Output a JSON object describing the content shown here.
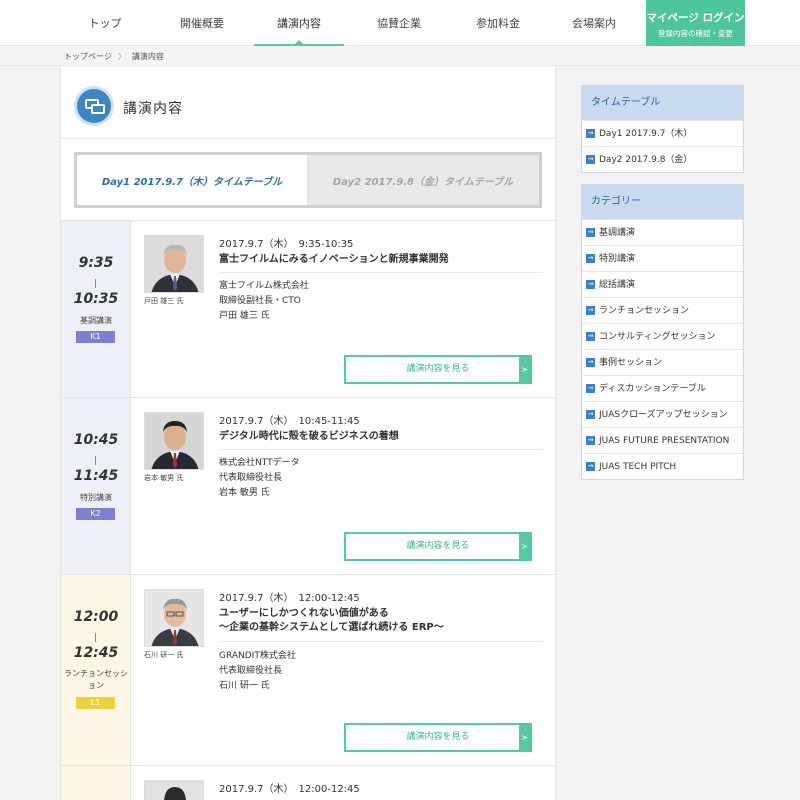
{
  "nav": {
    "items": [
      {
        "label": "トップ"
      },
      {
        "label": "開催概要"
      },
      {
        "label": "講演内容"
      },
      {
        "label": "協賛企業"
      },
      {
        "label": "参加料金"
      },
      {
        "label": "会場案内"
      }
    ],
    "mypage_title": "マイページ ログイン",
    "mypage_sub": "登録内容の確認・変更"
  },
  "breadcrumb": {
    "home": "トップページ",
    "separator": "〉",
    "current": "講演内容"
  },
  "page": {
    "title": "講演内容",
    "icon": "chat-bubbles-icon",
    "day_tabs": [
      "Day1 2017.9.7（木）タイムテーブル",
      "Day2 2017.9.8（金）タイムテーブル"
    ]
  },
  "sessions": [
    {
      "start": "9:35",
      "end": "10:35",
      "category": "基調講演",
      "badge": "K1",
      "photo_caption": "戸田 雄三 氏",
      "date": "2017.9.7（木）　9:35-10:35",
      "title": "富士フイルムにみるイノベーションと新規事業開発",
      "info": [
        "富士フイルム株式会社",
        "取締役副社長・CTO",
        "戸田 雄三 氏"
      ],
      "button": "講演内容を見る"
    },
    {
      "start": "10:45",
      "end": "11:45",
      "category": "特別講演",
      "badge": "K2",
      "photo_caption": "岩本 敏男 氏",
      "date": "2017.9.7（木）　10:45-11:45",
      "title": "デジタル時代に殻を破るビジネスの着想",
      "info": [
        "株式会社NTTデータ",
        "代表取締役社長",
        "岩本 敏男 氏"
      ],
      "button": "講演内容を見る"
    },
    {
      "start": "12:00",
      "end": "12:45",
      "category": "ランチョンセッション",
      "badge": "L1",
      "photo_caption": "石川 研一 氏",
      "date": "2017.9.7（木）　12:00-12:45",
      "title": "ユーザーにしかつくれない価値がある",
      "title2": "〜企業の基幹システムとして選ばれ続ける ERP〜",
      "info": [
        "GRANDIT株式会社",
        "代表取締役社長",
        "石川 研一 氏"
      ],
      "button": "講演内容を見る"
    },
    {
      "date": "2017.9.7（木）　12:00-12:45"
    }
  ],
  "sidebar": {
    "timetable_head": "タイムテーブル",
    "timetable": [
      "Day1 2017.9.7（木）",
      "Day2 2017.9.8（金）"
    ],
    "category_head": "カテゴリー",
    "categories": [
      "基調講演",
      "特別講演",
      "総括講演",
      "ランチョンセッション",
      "コンサルティングセッション",
      "事例セッション",
      "ディスカッションテーブル",
      "JUASクローズアップセッション",
      "JUAS FUTURE PRESENTATION",
      "JUAS TECH PITCH"
    ],
    "arrow": "→"
  },
  "colors": {
    "accent": "#57c9a4",
    "link_blue": "#2a6cb5",
    "badge_k": "#7d7fd0",
    "badge_l": "#ecd23c"
  }
}
